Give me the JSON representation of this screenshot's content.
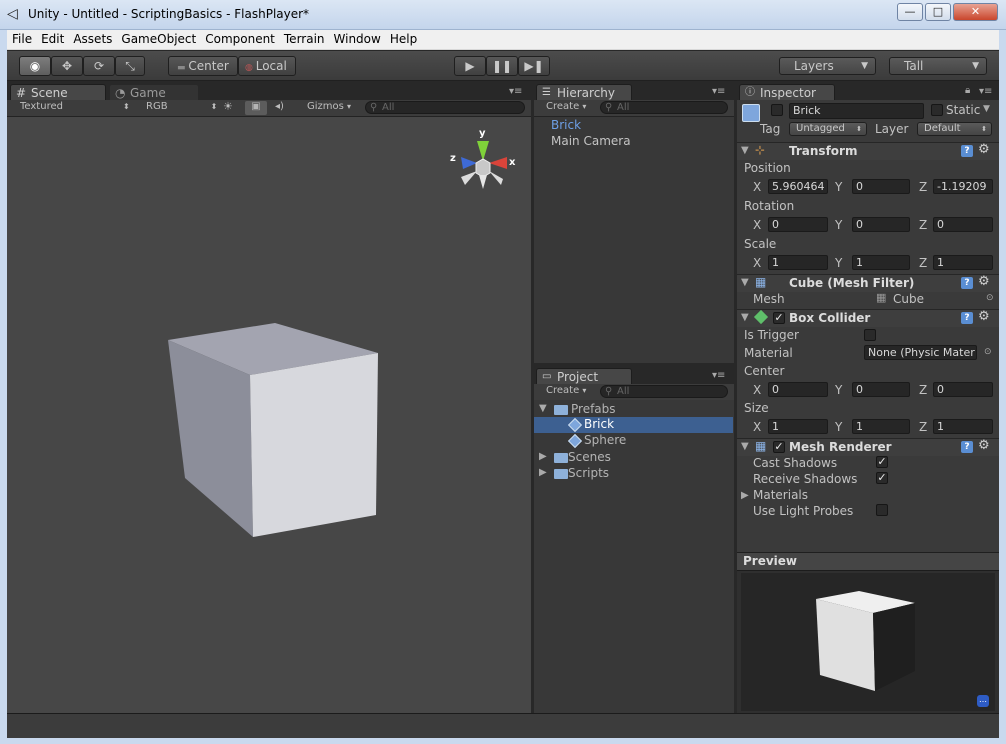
{
  "window": {
    "title": "Unity - Untitled - ScriptingBasics - FlashPlayer*",
    "min_glyph": "—",
    "max_glyph": "□",
    "close_glyph": "✕"
  },
  "menu": [
    "File",
    "Edit",
    "Assets",
    "GameObject",
    "Component",
    "Terrain",
    "Window",
    "Help"
  ],
  "toolbar": {
    "pivot": "Center",
    "space": "Local",
    "layers": "Layers",
    "layout": "Tall"
  },
  "scene": {
    "tab_scene": "Scene",
    "tab_game": "Game",
    "render_mode": "Textured",
    "color_mode": "RGB",
    "gizmos": "Gizmos",
    "search_placeholder": "All",
    "axis_x": "x",
    "axis_y": "y",
    "axis_z": "z"
  },
  "hierarchy": {
    "tab": "Hierarchy",
    "create": "Create",
    "search_placeholder": "All",
    "items": [
      "Brick",
      "Main Camera"
    ]
  },
  "project": {
    "tab": "Project",
    "create": "Create",
    "search_placeholder": "All",
    "items": [
      "Prefabs",
      "Brick",
      "Sphere",
      "Scenes",
      "Scripts"
    ]
  },
  "inspector": {
    "tab": "Inspector",
    "name": "Brick",
    "static": "Static",
    "tag_label": "Tag",
    "tag": "Untagged",
    "layer_label": "Layer",
    "layer": "Default",
    "transform": {
      "title": "Transform",
      "position_label": "Position",
      "rotation_label": "Rotation",
      "scale_label": "Scale",
      "x_label": "X",
      "y_label": "Y",
      "z_label": "Z",
      "position": [
        "5.960464",
        "0",
        "-1.19209"
      ],
      "rotation": [
        "0",
        "0",
        "0"
      ],
      "scale": [
        "1",
        "1",
        "1"
      ]
    },
    "mesh_filter": {
      "title": "Cube (Mesh Filter)",
      "mesh_label": "Mesh",
      "mesh": "Cube"
    },
    "box_collider": {
      "title": "Box Collider",
      "is_trigger_label": "Is Trigger",
      "material_label": "Material",
      "material": "None (Physic Mater",
      "center_label": "Center",
      "size_label": "Size",
      "center": [
        "0",
        "0",
        "0"
      ],
      "size": [
        "1",
        "1",
        "1"
      ]
    },
    "mesh_renderer": {
      "title": "Mesh Renderer",
      "cast_shadows_label": "Cast Shadows",
      "receive_shadows_label": "Receive Shadows",
      "materials_label": "Materials",
      "light_probes_label": "Use Light Probes"
    },
    "preview_title": "Preview"
  },
  "colors": {
    "accent_selection": "#3d6091",
    "selected_text": "#6e9fe6"
  }
}
